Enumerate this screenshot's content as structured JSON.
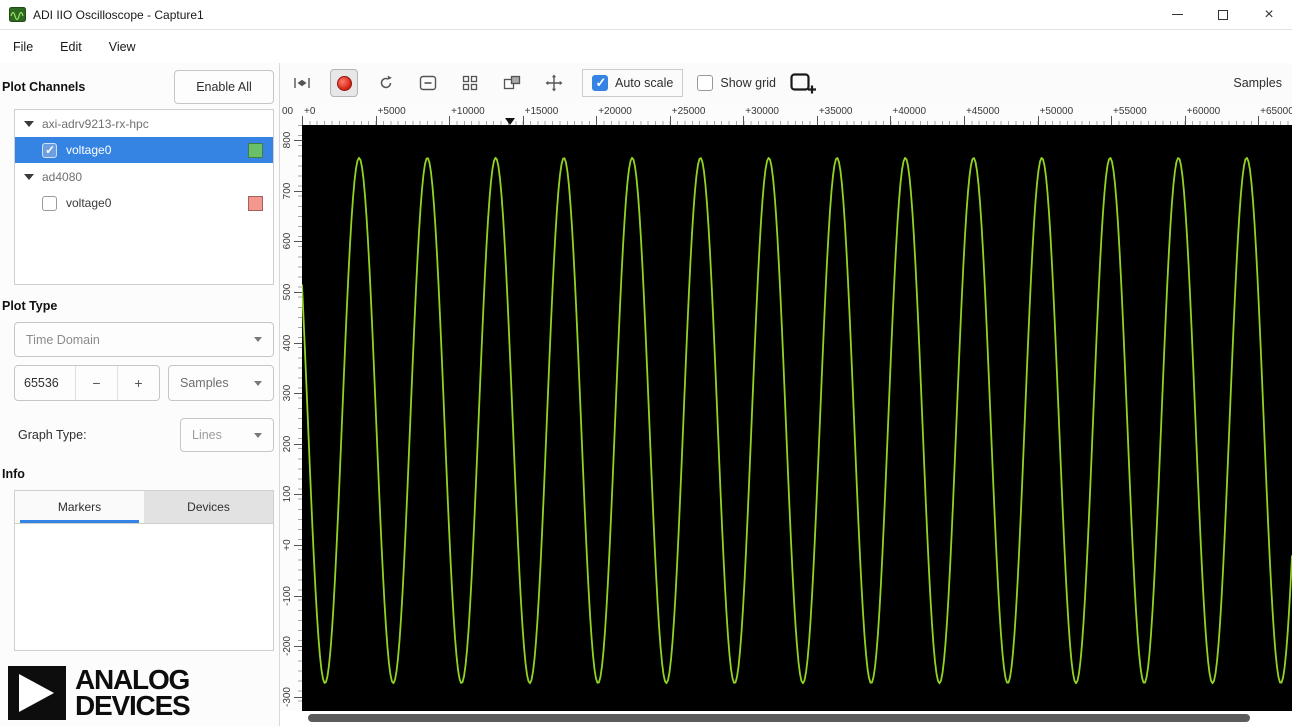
{
  "window": {
    "title": "ADI IIO Oscilloscope - Capture1"
  },
  "menu": {
    "items": [
      "File",
      "Edit",
      "View"
    ]
  },
  "sidebar": {
    "plot_channels_label": "Plot Channels",
    "enable_all_label": "Enable All",
    "devices": [
      {
        "name": "axi-adrv9213-rx-hpc",
        "expanded": true,
        "channels": [
          {
            "name": "voltage0",
            "checked": true,
            "selected": true,
            "color": "#6abf69"
          }
        ]
      },
      {
        "name": "ad4080",
        "expanded": true,
        "channels": [
          {
            "name": "voltage0",
            "checked": false,
            "selected": false,
            "color": "#f4978e"
          }
        ]
      }
    ],
    "plot_type_label": "Plot Type",
    "plot_type_value": "Time Domain",
    "sample_count": "65536",
    "spin_decrement_label": "−",
    "spin_increment_label": "+",
    "sample_unit_value": "Samples",
    "graph_type_label": "Graph Type:",
    "graph_type_value": "Lines",
    "info_label": "Info",
    "tabs": [
      {
        "label": "Markers",
        "active": true
      },
      {
        "label": "Devices",
        "active": false
      }
    ],
    "logo": {
      "line1": "ANALOG",
      "line2": "DEVICES"
    }
  },
  "toolbar": {
    "auto_scale_label": "Auto scale",
    "auto_scale_checked": true,
    "show_grid_label": "Show grid",
    "show_grid_checked": false,
    "samples_label": "Samples",
    "accent_color": "#3584e4"
  },
  "chart_data": {
    "type": "line",
    "title": "",
    "xlabel": "Samples",
    "ylabel": "",
    "x_ticks": [
      "00",
      "+0",
      "+5000",
      "+10000",
      "+15000",
      "+20000",
      "+25000",
      "+30000",
      "+35000",
      "+40000",
      "+45000",
      "+50000",
      "+55000",
      "+60000",
      "+65000"
    ],
    "y_ticks": [
      "800",
      "700",
      "600",
      "500",
      "400",
      "300",
      "200",
      "100",
      "+0",
      "-100",
      "-200",
      "-300"
    ],
    "x_range": [
      0,
      65536
    ],
    "y_range": [
      -330,
      830
    ],
    "grid": false,
    "background": "#000000",
    "series": [
      {
        "name": "voltage0",
        "color": "#92d322",
        "waveform": "sine",
        "amplitude": 520,
        "offset": 245,
        "cycles": 14.5,
        "phase": 2.6,
        "samples": 65536
      }
    ]
  }
}
